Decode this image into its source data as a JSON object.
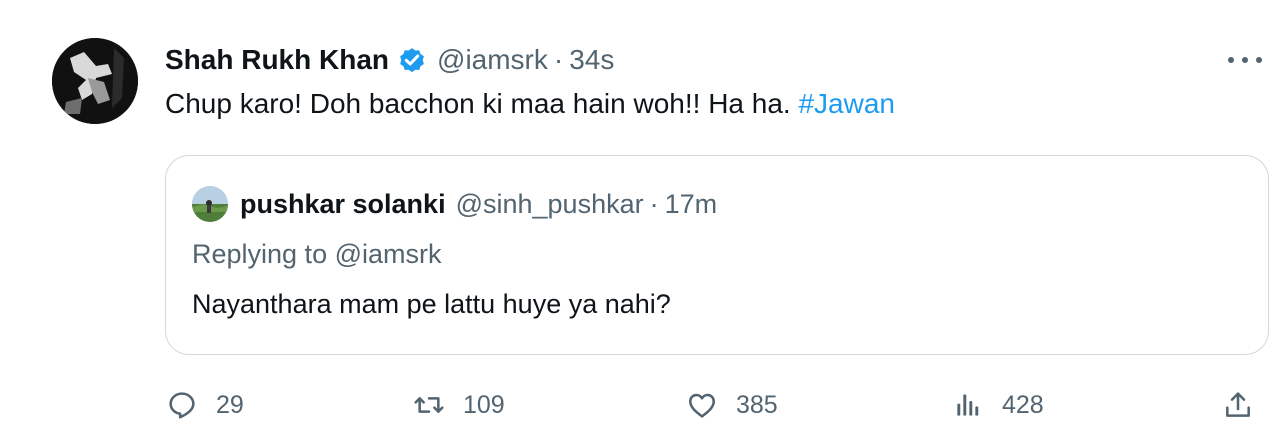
{
  "author": {
    "name": "Shah Rukh Khan",
    "handle": "@iamsrk",
    "separator": "·",
    "time": "34s",
    "verified_icon": "verified-badge-icon",
    "verified_color": "#1d9bf0"
  },
  "tweet": {
    "text": "Chup karo! Doh bacchon ki maa hain woh!! Ha ha.",
    "hashtag": "#Jawan",
    "hashtag_color": "#1d9bf0"
  },
  "more_icon": "more-dots-icon",
  "quote": {
    "name": "pushkar solanki",
    "handle": "@sinh_pushkar",
    "separator": "·",
    "time": "17m",
    "replying_to": "Replying to @iamsrk",
    "text": "Nayanthara mam pe lattu huye ya nahi?"
  },
  "actions": {
    "reply": {
      "icon": "reply-icon",
      "count": "29"
    },
    "retweet": {
      "icon": "retweet-icon",
      "count": "109"
    },
    "like": {
      "icon": "heart-icon",
      "count": "385"
    },
    "views": {
      "icon": "views-icon",
      "count": "428"
    },
    "share": {
      "icon": "share-icon"
    }
  }
}
